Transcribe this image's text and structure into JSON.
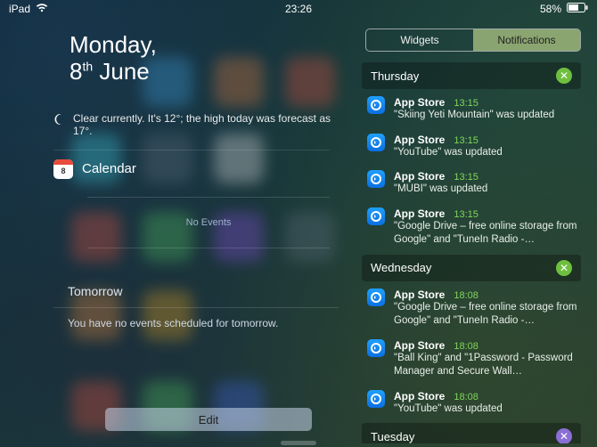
{
  "status_bar": {
    "device": "iPad",
    "time": "23:26",
    "battery_text": "58%"
  },
  "today": {
    "weekday": "Monday,",
    "day": "8",
    "ordinal": "th",
    "month": "June",
    "weather": "Clear currently. It's 12°; the high today was forecast as 17°.",
    "calendar_label": "Calendar",
    "no_events": "No Events",
    "tomorrow_label": "Tomorrow",
    "tomorrow_text": "You have no events scheduled for tomorrow.",
    "edit_label": "Edit"
  },
  "segmented": {
    "widgets": "Widgets",
    "notifications": "Notifications"
  },
  "day_headers": [
    "Thursday",
    "Wednesday",
    "Tuesday"
  ],
  "notifications": {
    "thursday": [
      {
        "app": "App Store",
        "time": "13:15",
        "text": "\"Skiing Yeti Mountain\" was updated"
      },
      {
        "app": "App Store",
        "time": "13:15",
        "text": "\"YouTube\" was updated"
      },
      {
        "app": "App Store",
        "time": "13:15",
        "text": "\"MUBI\" was updated"
      },
      {
        "app": "App Store",
        "time": "13:15",
        "text": "\"Google Drive – free online storage from Google\" and \"TuneIn Radio -…"
      }
    ],
    "wednesday": [
      {
        "app": "App Store",
        "time": "18:08",
        "text": "\"Google Drive – free online storage from Google\" and \"TuneIn Radio -…"
      },
      {
        "app": "App Store",
        "time": "18:08",
        "text": "\"Ball King\" and \"1Password - Password Manager and Secure Wall…"
      },
      {
        "app": "App Store",
        "time": "18:08",
        "text": "\"YouTube\" was updated"
      }
    ],
    "tuesday": []
  }
}
